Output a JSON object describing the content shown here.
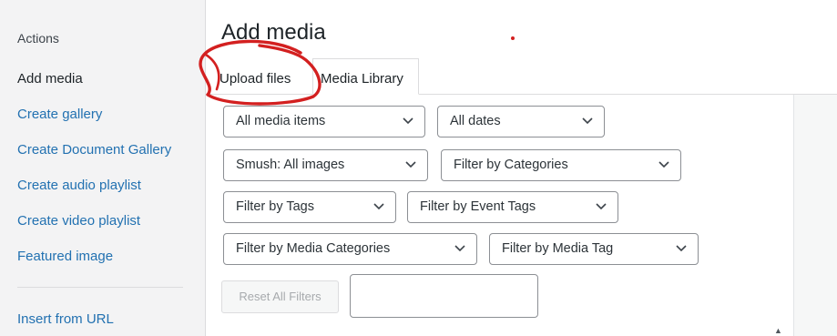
{
  "sidebar": {
    "heading": "Actions",
    "items": [
      {
        "label": "Add media",
        "active": true
      },
      {
        "label": "Create gallery"
      },
      {
        "label": "Create Document Gallery"
      },
      {
        "label": "Create audio playlist"
      },
      {
        "label": "Create video playlist"
      },
      {
        "label": "Featured image"
      },
      {
        "label": "Insert from URL"
      }
    ]
  },
  "main": {
    "title": "Add media",
    "tabs": [
      {
        "label": "Upload files"
      },
      {
        "label": "Media Library",
        "active": true
      }
    ],
    "filters": [
      {
        "selected": "All media items"
      },
      {
        "selected": "All dates"
      },
      {
        "selected": "Smush: All images"
      },
      {
        "selected": "Filter by Categories"
      },
      {
        "selected": "Filter by Tags"
      },
      {
        "selected": "Filter by Event Tags"
      },
      {
        "selected": "Filter by Media Categories"
      },
      {
        "selected": "Filter by Media Tag"
      }
    ],
    "reset_label": "Reset All Filters",
    "search_value": ""
  },
  "icons": {
    "select_arrow": "chevron-down-icon",
    "scroll_up": "scroll-up-arrow-icon"
  },
  "colors": {
    "link": "#2271b1",
    "annotation": "#d32020"
  }
}
